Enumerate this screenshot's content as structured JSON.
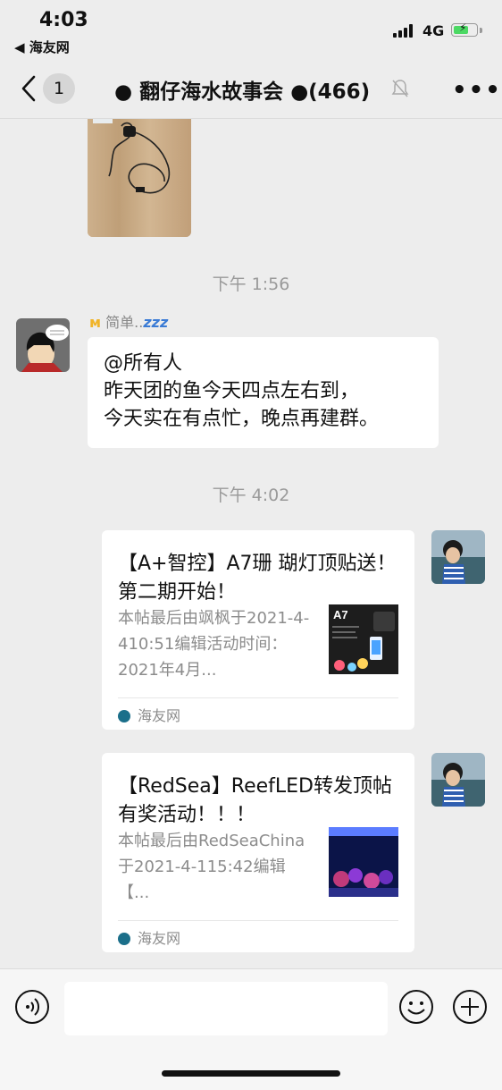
{
  "status_bar": {
    "time": "4:03",
    "back_app": "◀ 海友网",
    "network": "4G"
  },
  "header": {
    "unread_count": "1",
    "title": "● 翻仔海水故事会 ●(466)"
  },
  "messages": {
    "timestamp_1": "下午 1:56",
    "sender_name": "简单..",
    "sender_zz": "zzz",
    "text_line_1": "@所有人",
    "text_line_2": "昨天团的鱼今天四点左右到，",
    "text_line_3": "今天实在有点忙，晚点再建群。",
    "timestamp_2": "下午 4:02",
    "card_1": {
      "title": "【A+智控】A7珊 瑚灯顶贴送！第二期开始！",
      "description": "本帖最后由飒枫于2021-4-410:51编辑活动时间：2021年4月...",
      "thumb_label": "A7",
      "source": "海友网"
    },
    "card_2": {
      "title": "【RedSea】ReefLED转发顶帖有奖活动！！！",
      "description": "本帖最后由RedSeaChina于2021-4-115:42编辑【...",
      "source": "海友网"
    }
  },
  "colors": {
    "background": "#ededed",
    "bubble": "#ffffff",
    "timestamp": "#9a9a9a",
    "secondary_text": "#8c8c8c",
    "battery": "#4cd964"
  }
}
